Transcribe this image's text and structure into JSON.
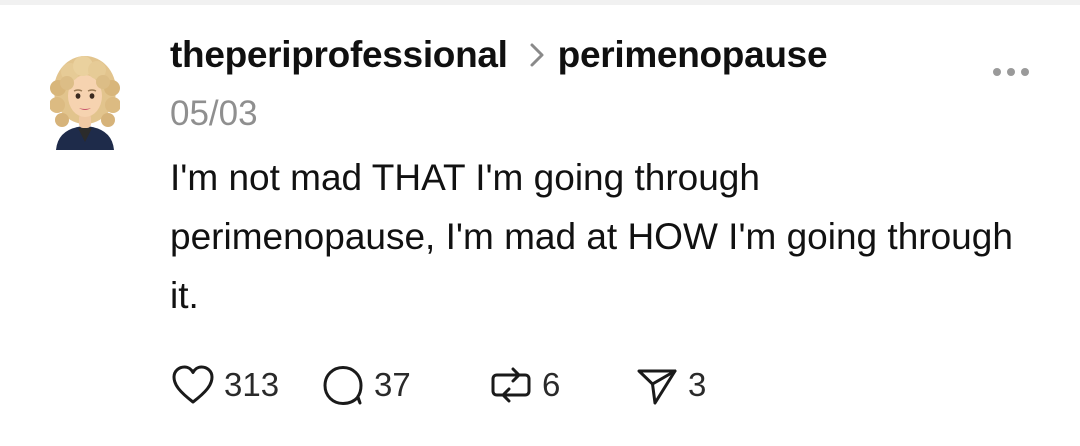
{
  "post": {
    "username": "theperiprofessional",
    "community": "perimenopause",
    "date": "05/03",
    "text": "I'm not mad THAT I'm going through perimenopause, I'm mad at HOW I'm going through it."
  },
  "actions": {
    "likes": "313",
    "replies": "37",
    "reposts": "6",
    "shares": "3"
  },
  "icons": {
    "avatar": "memoji-avatar",
    "chevron": "chevron-right-icon",
    "more": "more-options-icon",
    "like": "heart-icon",
    "reply": "comment-bubble-icon",
    "repost": "repost-icon",
    "share": "send-icon"
  },
  "colors": {
    "text": "#101010",
    "muted": "#8f8f8f",
    "icon": "#1a1a1a"
  }
}
